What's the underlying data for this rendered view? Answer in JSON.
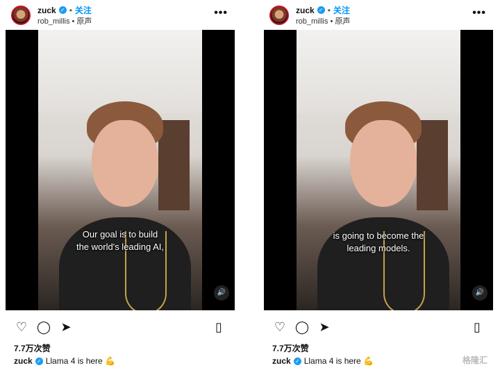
{
  "posts": [
    {
      "username": "zuck",
      "follow_label": "关注",
      "subtitle": "rob_millis • 原声",
      "caption_lines": [
        "Our goal is to build",
        "the world's leading AI,"
      ],
      "likes": "7.7万次赞",
      "post_caption": "Llama 4 is here 💪"
    },
    {
      "username": "zuck",
      "follow_label": "关注",
      "subtitle": "rob_millis • 原声",
      "caption_lines": [
        "is going to become the",
        "leading models."
      ],
      "likes": "7.7万次赞",
      "post_caption": "Llama 4 is here 💪"
    }
  ],
  "ui": {
    "more_label": "•••",
    "sound_icon": "🔊",
    "watermark": "格隆汇"
  },
  "colors": {
    "follow": "#0095f6",
    "verified": "#1d9bf0"
  }
}
